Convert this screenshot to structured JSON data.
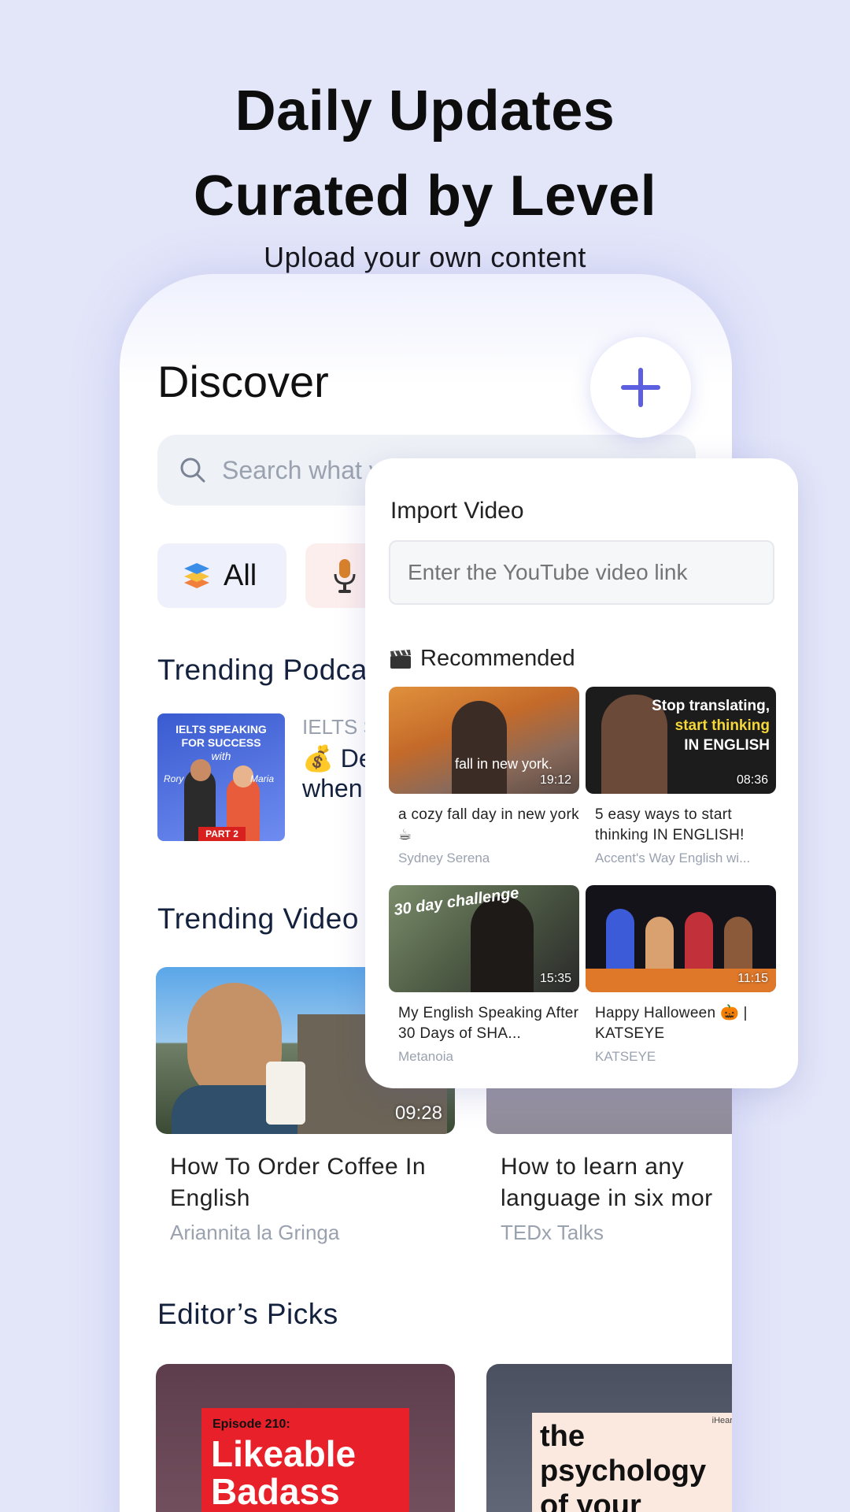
{
  "headline": {
    "line1": "Daily Updates",
    "line2": "Curated by Level",
    "subtitle": "Upload your own content"
  },
  "discover": {
    "title": "Discover",
    "search_placeholder": "Search what y",
    "chips": [
      {
        "label": "All",
        "icon": "layers-icon"
      },
      {
        "label": "",
        "icon": "microphone-icon"
      }
    ],
    "trending_podcasts_title": "Trending Podca",
    "podcast": {
      "meta": "IELTS S",
      "title_line1": "💰 De",
      "title_line2": "when",
      "cover_line1": "IELTS SPEAKING",
      "cover_line2": "FOR SUCCESS",
      "cover_line3": "with",
      "cover_host1": "Rory",
      "cover_host2": "Maria",
      "cover_part": "PART 2"
    },
    "trending_videos_title": "Trending Video",
    "videos": [
      {
        "title": "How To Order Coffee In English",
        "channel": "Ariannita la Gringa",
        "duration": "09:28"
      },
      {
        "title": "How to learn any language in six mor",
        "channel": "TEDx Talks",
        "duration": ""
      }
    ],
    "editors_picks_title": "Editor’s Picks",
    "picks": [
      {
        "episode": "Episode 210:",
        "title": "Likeable Badass"
      },
      {
        "title": "the psychology of your",
        "brand": "iHeart"
      }
    ]
  },
  "import_popup": {
    "title": "Import Video",
    "input_placeholder": "Enter the YouTube video link",
    "recommended_label": "Recommended",
    "items": [
      {
        "title": "a cozy fall day in new york ☕",
        "channel": "Sydney Serena",
        "duration": "19:12",
        "overlay": "fall in new york."
      },
      {
        "title": "5 easy ways to start thinking IN ENGLISH!",
        "channel": "Accent's Way English wi...",
        "duration": "08:36",
        "overlay1": "Stop translating,",
        "overlay2": "start thinking",
        "overlay3": "IN ENGLISH"
      },
      {
        "title": "My English Speaking After 30 Days of SHA...",
        "channel": "Metanoia",
        "duration": "15:35",
        "overlay": "30 day challenge"
      },
      {
        "title": "Happy Halloween 🎃 | KATSEYE",
        "channel": "KATSEYE",
        "duration": "11:15"
      }
    ]
  },
  "colors": {
    "background": "#e3e6f9",
    "accent": "#5b5fe0",
    "heading": "#14213d",
    "muted": "#9aa2af"
  }
}
